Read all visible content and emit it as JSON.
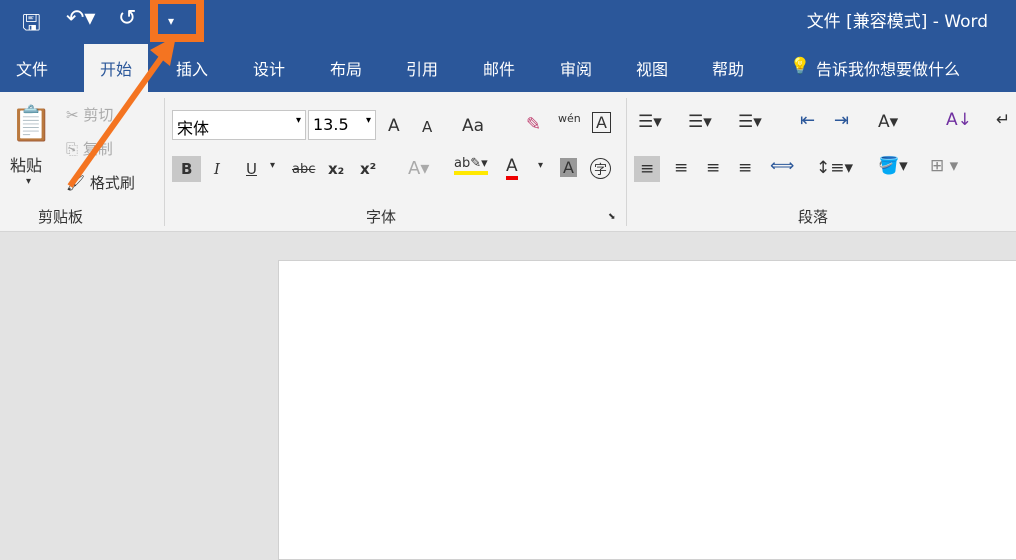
{
  "title_bar": {
    "window_title": "文件 [兼容模式] - Word",
    "save_icon": "save-icon",
    "undo_icon": "undo-icon",
    "redo_icon": "redo-icon",
    "customize_icon": "customize-quick-access-icon",
    "accent": "#f47421"
  },
  "tabs": [
    "文件",
    "开始",
    "插入",
    "设计",
    "布局",
    "引用",
    "邮件",
    "审阅",
    "视图",
    "帮助"
  ],
  "tell_me": "告诉我你想要做什么",
  "clipboard": {
    "paste": "粘贴",
    "cut": "剪切",
    "copy": "复制",
    "format_painter": "格式刷",
    "group": "剪贴板"
  },
  "font": {
    "name": "宋体",
    "size": "13.5",
    "grow": "A",
    "shrink": "A",
    "case": "Aa",
    "bold": "B",
    "italic": "I",
    "underline": "U",
    "strike": "abc",
    "sub": "x₂",
    "sup": "x²",
    "phonetic": "wén",
    "group": "字体"
  },
  "paragraph": {
    "group": "段落"
  }
}
